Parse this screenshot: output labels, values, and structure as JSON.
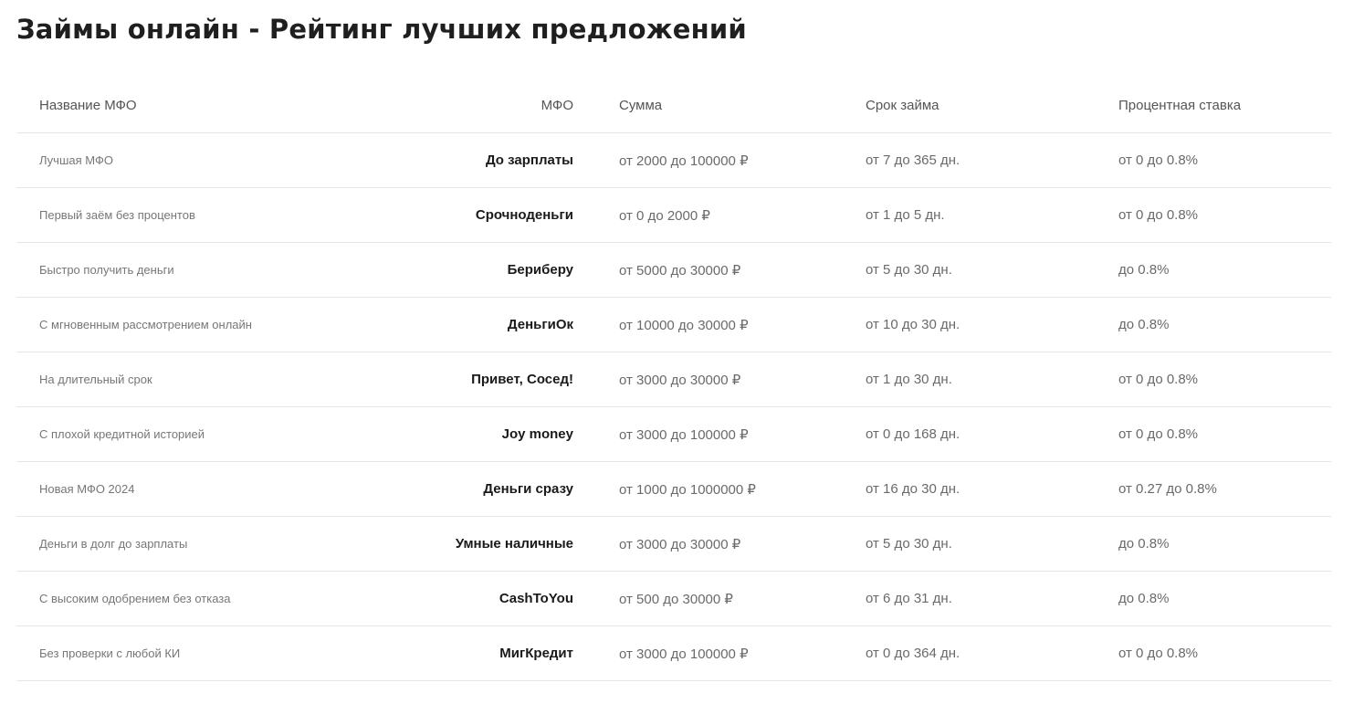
{
  "page": {
    "title": "Займы онлайн - Рейтинг лучших предложений"
  },
  "table": {
    "headers": {
      "category": "Название МФО",
      "mfo": "МФО",
      "sum": "Сумма",
      "term": "Срок займа",
      "rate": "Процентная ставка"
    },
    "rows": [
      {
        "category": "Лучшая МФО",
        "mfo": "До зарплаты",
        "sum": "от 2000 до 100000 ₽",
        "term": "от 7 до 365 дн.",
        "rate": "от 0 до 0.8%"
      },
      {
        "category": "Первый заём без процентов",
        "mfo": "Срочноденьги",
        "sum": "от 0 до 2000 ₽",
        "term": "от 1 до 5 дн.",
        "rate": "от 0 до 0.8%"
      },
      {
        "category": "Быстро получить деньги",
        "mfo": "Бериберу",
        "sum": "от 5000 до 30000 ₽",
        "term": "от 5 до 30 дн.",
        "rate": "до 0.8%"
      },
      {
        "category": "С мгновенным рассмотрением онлайн",
        "mfo": "ДеньгиОк",
        "sum": "от 10000 до 30000 ₽",
        "term": "от 10 до 30 дн.",
        "rate": "до 0.8%"
      },
      {
        "category": "На длительный срок",
        "mfo": "Привет, Сосед!",
        "sum": "от 3000 до 30000 ₽",
        "term": "от 1 до 30 дн.",
        "rate": "от 0 до 0.8%"
      },
      {
        "category": "С плохой кредитной историей",
        "mfo": "Joy money",
        "sum": "от 3000 до 100000 ₽",
        "term": "от 0 до 168 дн.",
        "rate": "от 0 до 0.8%"
      },
      {
        "category": "Новая МФО 2024",
        "mfo": "Деньги сразу",
        "sum": "от 1000 до 1000000 ₽",
        "term": "от 16 до 30 дн.",
        "rate": "от 0.27 до 0.8%"
      },
      {
        "category": "Деньги в долг до зарплаты",
        "mfo": "Умные наличные",
        "sum": "от 3000 до 30000 ₽",
        "term": "от 5 до 30 дн.",
        "rate": "до 0.8%"
      },
      {
        "category": "С высоким одобрением без отказа",
        "mfo": "CashToYou",
        "sum": "от 500 до 30000 ₽",
        "term": "от 6 до 31 дн.",
        "rate": "до 0.8%"
      },
      {
        "category": "Без проверки с любой КИ",
        "mfo": "МигКредит",
        "sum": "от 3000 до 100000 ₽",
        "term": "от 0 до 364 дн.",
        "rate": "от 0 до 0.8%"
      }
    ]
  }
}
